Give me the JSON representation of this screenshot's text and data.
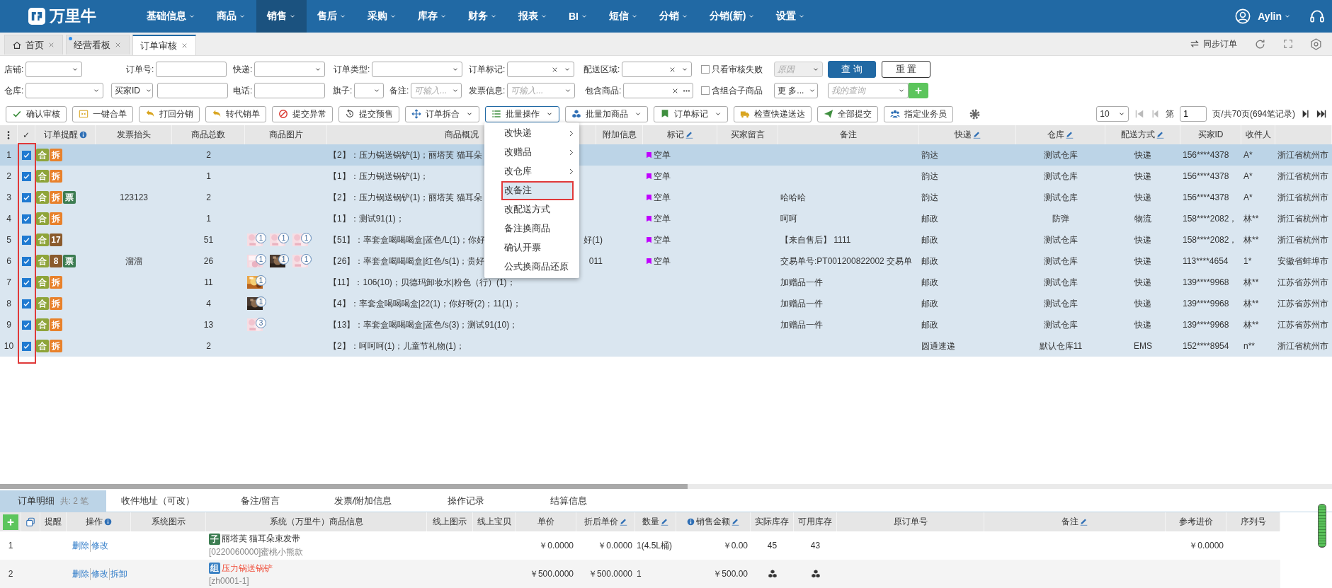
{
  "app": {
    "logo_text": "万里牛",
    "user": "Aylin"
  },
  "nav": [
    {
      "label": "基础信息",
      "selected": false
    },
    {
      "label": "商品",
      "selected": false
    },
    {
      "label": "销售",
      "selected": true
    },
    {
      "label": "售后",
      "selected": false
    },
    {
      "label": "采购",
      "selected": false
    },
    {
      "label": "库存",
      "selected": false
    },
    {
      "label": "财务",
      "selected": false
    },
    {
      "label": "报表",
      "selected": false
    },
    {
      "label": "BI",
      "selected": false
    },
    {
      "label": "短信",
      "selected": false
    },
    {
      "label": "分销",
      "selected": false
    },
    {
      "label": "分销(新)",
      "selected": false
    },
    {
      "label": "设置",
      "selected": false
    }
  ],
  "tabs": [
    {
      "label": "首页",
      "kind": "home",
      "selected": false,
      "dot": false
    },
    {
      "label": "经营看板",
      "kind": "plain",
      "selected": false,
      "dot": true
    },
    {
      "label": "订单审核",
      "kind": "plain",
      "selected": true,
      "dot": false
    }
  ],
  "tab_actions": {
    "sync": "同步订单"
  },
  "filters": [
    [
      {
        "kind": "select",
        "label": "店铺:"
      },
      {
        "kind": "input",
        "label": "订单号:"
      },
      {
        "kind": "select",
        "label": "快递:"
      },
      {
        "kind": "select",
        "label": "订单类型:"
      },
      {
        "kind": "select",
        "label": "订单标记:",
        "clearable": true
      },
      {
        "kind": "select",
        "label": "配送区域:",
        "clearable": true
      },
      {
        "kind": "checkbox",
        "label": "只看审核失败",
        "checked": false
      },
      {
        "kind": "select",
        "placeholder": "原因",
        "disabled": true
      },
      {
        "kind": "button",
        "label": "查 询",
        "primary": true
      },
      {
        "kind": "button",
        "label": "重 置",
        "primary": false
      }
    ],
    [
      {
        "kind": "select",
        "label": "仓库:"
      },
      {
        "kind": "select",
        "value": "买家ID"
      },
      {
        "kind": "input"
      },
      {
        "kind": "input",
        "label": "电话:"
      },
      {
        "kind": "select",
        "label": "旗子:"
      },
      {
        "kind": "select",
        "label": "备注:",
        "placeholder": "可输入..."
      },
      {
        "kind": "select",
        "label": "发票信息:",
        "placeholder": "可输入..."
      },
      {
        "kind": "input",
        "label": "包含商品:",
        "clearable": true,
        "more": true
      },
      {
        "kind": "checkbox",
        "label": "含组合子商品",
        "checked": false
      },
      {
        "kind": "select",
        "value": "更 多..."
      },
      {
        "kind": "select",
        "placeholder": "我的查询",
        "add": true
      }
    ]
  ],
  "toolbar": [
    {
      "label": "确认审核",
      "kind": "button"
    },
    {
      "label": "一键合单",
      "kind": "button"
    },
    {
      "label": "打回分销",
      "kind": "button"
    },
    {
      "label": "转代销单",
      "kind": "button"
    },
    {
      "label": "提交异常",
      "kind": "button"
    },
    {
      "label": "提交预售",
      "kind": "button"
    },
    {
      "label": "订单拆合",
      "kind": "dropdown"
    },
    {
      "label": "批量操作",
      "kind": "dropdown"
    },
    {
      "label": "批量加商品",
      "kind": "dropdown"
    },
    {
      "label": "订单标记",
      "kind": "dropdown"
    },
    {
      "label": "检查快递送达",
      "kind": "button"
    },
    {
      "label": "全部提交",
      "kind": "button"
    },
    {
      "label": "指定业务员",
      "kind": "button"
    },
    {
      "kind": "settings"
    }
  ],
  "pagination": {
    "page_size": "10",
    "can_prev": false,
    "can_next": true,
    "prefix": "第",
    "page": "1",
    "suffix": "页/共70页(694笔记录)"
  },
  "table": {
    "checkbox_column_outlined": true,
    "columns": [
      {
        "kind": "menu"
      },
      {
        "kind": "plain",
        "label": "✓"
      },
      {
        "kind": "info",
        "label": "订单提醒"
      },
      {
        "kind": "plain",
        "label": "发票抬头"
      },
      {
        "kind": "plain",
        "label": "商品总数"
      },
      {
        "kind": "plain",
        "label": "商品图片"
      },
      {
        "kind": "plain",
        "label": "商品概况"
      },
      {
        "kind": "plain",
        "label": "附加信息"
      },
      {
        "kind": "edit",
        "label": "标记"
      },
      {
        "kind": "plain",
        "label": "买家留言"
      },
      {
        "kind": "plain",
        "label": "备注"
      },
      {
        "kind": "edit",
        "label": "快递"
      },
      {
        "kind": "edit",
        "label": "仓库"
      },
      {
        "kind": "edit",
        "label": "配送方式"
      },
      {
        "kind": "plain",
        "label": "买家ID"
      },
      {
        "kind": "plain",
        "label": "收件人"
      },
      {
        "kind": "blank"
      }
    ],
    "rows": [
      {
        "index": "1",
        "selected": true,
        "checked": true,
        "badges": [
          {
            "text": "合",
            "color": "#8ea43a"
          },
          {
            "text": "拆",
            "color": "#e8812b"
          }
        ],
        "total": "2",
        "summary": "【2】：压力锅送锅铲(1)；丽塔芙 猫耳朵",
        "mark": {
          "text": "空单",
          "color": "#c000ff"
        },
        "courier": "韵达",
        "warehouse": "测试仓库",
        "delivery": "快递",
        "buyer_id": "156****4378",
        "receiver": "A*",
        "address": "浙江省杭州市"
      },
      {
        "index": "2",
        "selected": false,
        "checked": true,
        "badges": [
          {
            "text": "合",
            "color": "#8ea43a"
          },
          {
            "text": "拆",
            "color": "#e8812b"
          }
        ],
        "total": "1",
        "summary": "【1】：压力锅送锅铲(1)；",
        "mark": {
          "text": "空单",
          "color": "#c000ff"
        },
        "courier": "韵达",
        "warehouse": "测试仓库",
        "delivery": "快递",
        "buyer_id": "156****4378",
        "receiver": "A*",
        "address": "浙江省杭州市"
      },
      {
        "index": "3",
        "selected": false,
        "checked": true,
        "badges": [
          {
            "text": "合",
            "color": "#8ea43a"
          },
          {
            "text": "拆",
            "color": "#e8812b"
          },
          {
            "text": "票",
            "color": "#3d7d52"
          }
        ],
        "invoice_title": "123123",
        "total": "2",
        "summary": "【2】：压力锅送锅铲(1)；丽塔芙 猫耳朵",
        "mark": {
          "text": "空单",
          "color": "#c000ff"
        },
        "note": "哈哈哈",
        "courier": "韵达",
        "warehouse": "测试仓库",
        "delivery": "快递",
        "buyer_id": "156****4378",
        "receiver": "A*",
        "address": "浙江省杭州市"
      },
      {
        "index": "4",
        "selected": false,
        "checked": true,
        "badges": [
          {
            "text": "合",
            "color": "#8ea43a"
          },
          {
            "text": "拆",
            "color": "#e8812b"
          }
        ],
        "total": "1",
        "summary": "【1】：测试91(1)；",
        "mark": {
          "text": "空单",
          "color": "#c000ff"
        },
        "note": "呵呵",
        "courier": "邮政",
        "warehouse": "防弹",
        "delivery": "物流",
        "buyer_id": "158****2082，",
        "receiver": "林**",
        "address": "浙江省杭州市"
      },
      {
        "index": "5",
        "selected": false,
        "checked": true,
        "badges": [
          {
            "text": "合",
            "color": "#8ea43a"
          },
          {
            "text": "17",
            "color": "#8a5a2c"
          }
        ],
        "total": "51",
        "images": [
          {
            "count": "1"
          },
          {
            "count": "1"
          },
          {
            "count": "1"
          }
        ],
        "summary": "【51】：率套盒喝喝喝盒|蓝色/L(1)；你好",
        "summary_tail": "好(1)",
        "mark": {
          "text": "空单",
          "color": "#c000ff"
        },
        "note": "【来自售后】 1111",
        "courier": "邮政",
        "warehouse": "测试仓库",
        "delivery": "快递",
        "buyer_id": "158****2082，",
        "receiver": "林**",
        "address": "浙江省杭州市"
      },
      {
        "index": "6",
        "selected": false,
        "checked": true,
        "badges": [
          {
            "text": "合",
            "color": "#8ea43a"
          },
          {
            "text": "8",
            "color": "#8a5a2c"
          },
          {
            "text": "票",
            "color": "#3d7d52"
          }
        ],
        "invoice_title": "溜溜",
        "total": "26",
        "images": [
          {
            "count": "1"
          },
          {
            "count": "1"
          },
          {
            "count": "1"
          }
        ],
        "summary": "【26】：率套盒喝喝喝盒|红色/s(1)；贵好",
        "summary_tail": "011",
        "mark": {
          "text": "空单",
          "color": "#c000ff"
        },
        "note": "交易单号:PT001200822002 交易单",
        "courier": "邮政",
        "warehouse": "测试仓库",
        "delivery": "快递",
        "buyer_id": "113****4654",
        "receiver": "1*",
        "address": "安徽省蚌埠市"
      },
      {
        "index": "7",
        "selected": false,
        "checked": true,
        "badges": [
          {
            "text": "合",
            "color": "#8ea43a"
          },
          {
            "text": "拆",
            "color": "#e8812b"
          }
        ],
        "total": "11",
        "images": [
          {
            "count": "1"
          }
        ],
        "summary": "【11】：106(10)；贝德玛卸妆水|粉色（行）(1)；",
        "note": "加赠品一件",
        "courier": "邮政",
        "warehouse": "测试仓库",
        "delivery": "快递",
        "buyer_id": "139****9968",
        "receiver": "林**",
        "address": "江苏省苏州市"
      },
      {
        "index": "8",
        "selected": false,
        "checked": true,
        "badges": [
          {
            "text": "合",
            "color": "#8ea43a"
          },
          {
            "text": "拆",
            "color": "#e8812b"
          }
        ],
        "total": "4",
        "images": [
          {
            "count": "1"
          }
        ],
        "summary": "【4】：率套盒喝喝喝盒|22(1)；你好呀(2)；11(1)；",
        "note": "加赠品一件",
        "courier": "邮政",
        "warehouse": "测试仓库",
        "delivery": "快递",
        "buyer_id": "139****9968",
        "receiver": "林**",
        "address": "江苏省苏州市"
      },
      {
        "index": "9",
        "selected": false,
        "checked": true,
        "badges": [
          {
            "text": "合",
            "color": "#8ea43a"
          },
          {
            "text": "拆",
            "color": "#e8812b"
          }
        ],
        "total": "13",
        "images": [
          {
            "count": "3"
          }
        ],
        "summary": "【13】：率套盒喝喝喝盒|蓝色/s(3)；测试91(10)；",
        "note": "加赠品一件",
        "courier": "邮政",
        "warehouse": "测试仓库",
        "delivery": "快递",
        "buyer_id": "139****9968",
        "receiver": "林**",
        "address": "江苏省苏州市"
      },
      {
        "index": "10",
        "selected": false,
        "checked": true,
        "badges": [
          {
            "text": "合",
            "color": "#8ea43a"
          },
          {
            "text": "拆",
            "color": "#e8812b"
          }
        ],
        "total": "2",
        "summary": "【2】：呵呵呵(1)；儿童节礼物(1)；",
        "courier": "圆通速递",
        "warehouse": "默认仓库11",
        "delivery": "EMS",
        "buyer_id": "152****8954",
        "receiver": "n**",
        "address": "浙江省杭州市"
      }
    ]
  },
  "batch_menu": [
    {
      "label": "改快递",
      "submenu": true,
      "outlined": false
    },
    {
      "label": "改赠品",
      "submenu": true,
      "outlined": false
    },
    {
      "label": "改仓库",
      "submenu": true,
      "outlined": false
    },
    {
      "label": "改备注",
      "submenu": false,
      "outlined": true
    },
    {
      "label": "改配送方式",
      "submenu": false,
      "outlined": false
    },
    {
      "label": "备注换商品",
      "submenu": false,
      "outlined": false
    },
    {
      "label": "确认开票",
      "submenu": false,
      "outlined": false
    },
    {
      "label": "公式换商品还原",
      "submenu": false,
      "outlined": false
    }
  ],
  "detail": {
    "tabs": [
      {
        "label": "订单明细",
        "count": "共: 2 笔",
        "selected": true
      },
      {
        "label": "收件地址（可改）",
        "selected": false
      },
      {
        "label": "备注/留言",
        "selected": false
      },
      {
        "label": "发票/附加信息",
        "selected": false
      },
      {
        "label": "操作记录",
        "selected": false
      },
      {
        "label": "结算信息",
        "selected": false
      }
    ],
    "columns": [
      {
        "kind": "add"
      },
      {
        "kind": "copy"
      },
      {
        "kind": "text",
        "label": "提醒"
      },
      {
        "kind": "text",
        "label": "操作",
        "info": true
      },
      {
        "kind": "text",
        "label": "系统图示"
      },
      {
        "kind": "text",
        "label": "系统（万里牛）商品信息"
      },
      {
        "kind": "text",
        "label": "线上图示"
      },
      {
        "kind": "text",
        "label": "线上宝贝"
      },
      {
        "kind": "text",
        "label": "单价"
      },
      {
        "kind": "text",
        "label": "折后单价",
        "editable": true
      },
      {
        "kind": "text",
        "label": "数量",
        "editable": true
      },
      {
        "kind": "text",
        "label": "销售金额",
        "info": true,
        "editable": true
      },
      {
        "kind": "text",
        "label": "实际库存"
      },
      {
        "kind": "text",
        "label": "可用库存"
      },
      {
        "kind": "text",
        "label": "原订单号"
      },
      {
        "kind": "text",
        "label": "备注",
        "editable": true
      },
      {
        "kind": "text",
        "label": "参考进价"
      },
      {
        "kind": "text",
        "label": "序列号"
      }
    ],
    "rows": [
      {
        "index": "1",
        "ops": [
          "删除",
          "修改"
        ],
        "tag": {
          "text": "子",
          "color": "#3d7d52"
        },
        "name": "丽塔芙 猫耳朵束发带",
        "name_alert": false,
        "code": "[0220060000]蜜桃小熊款",
        "price": "￥0.0000",
        "discount_price": "￥0.0000",
        "qty": "1(4.5L桶)",
        "amount": "￥0.00",
        "stock_icons": false,
        "actual_stock": "45",
        "available_stock": "43",
        "ref_price": "￥0.0000"
      },
      {
        "index": "2",
        "ops": [
          "删除",
          "修改",
          "拆卸"
        ],
        "tag": {
          "text": "组",
          "color": "#3b82c4"
        },
        "name": "压力锅送锅铲",
        "name_alert": true,
        "code": "[zh0001-1]",
        "price": "￥500.0000",
        "discount_price": "￥500.0000",
        "qty": "1",
        "amount": "￥500.00",
        "stock_icons": true
      }
    ]
  }
}
